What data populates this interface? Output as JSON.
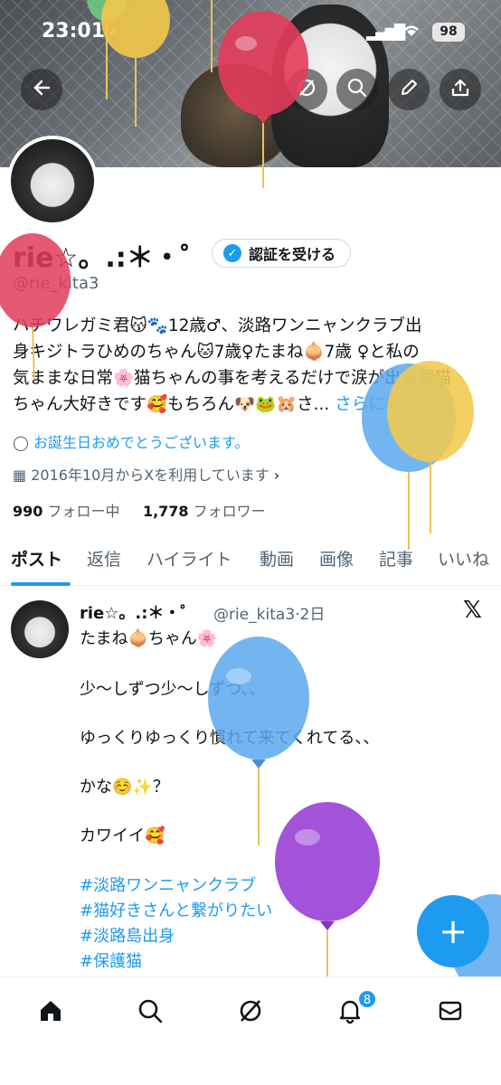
{
  "status_bar": {
    "time": "23:01",
    "battery": "98"
  },
  "profile": {
    "name": "rie☆。.:＊・゜",
    "verify_label": "認証を受ける",
    "handle": "@rie_kita3",
    "bio_lines": [
      "ハチワレガミ君😽🐾12歳♂、淡路ワンニャンクラブ出",
      "身キジトラひめのちゃん🐱7歳♀たまね🧅7歳 ♀と私の",
      "気ままな日常🌸猫ちゃんの事を考えるだけで涙が出る程猫",
      "ちゃん大好きです🥰もちろん🐶🐸🐹さ..."
    ],
    "bio_more": "さらに表示",
    "birthday": "お誕生日おめでとうございます。",
    "joined": "2016年10月からXを利用しています",
    "following_count": "990",
    "following_label": "フォロー中",
    "followers_count": "1,778",
    "followers_label": "フォロワー"
  },
  "tabs": [
    "ポスト",
    "返信",
    "ハイライト",
    "動画",
    "画像",
    "記事",
    "いいね"
  ],
  "post": {
    "name": "rie☆。.:＊・゜",
    "meta": "@rie_kita3·2日",
    "lines": [
      "たまね🧅ちゃん🌸",
      "少〜しずつ少〜しずつ、、",
      "ゆっくりゆっくり慣れて来てくれてる、、",
      "かな☺️✨？",
      "カワイイ🥰"
    ],
    "hashtags": [
      "#淡路ワンニャンクラブ",
      "#猫好きさんと繋がりたい",
      "#淡路島出身",
      "#保護猫"
    ]
  },
  "bottom_nav": {
    "notification_badge": "8"
  },
  "colors": {
    "accent": "#1d9bf0",
    "balloon_red": "#e23c5a",
    "balloon_blue": "#5aa8ef",
    "balloon_yellow": "#f2c94c",
    "balloon_purple": "#9b43d6"
  }
}
